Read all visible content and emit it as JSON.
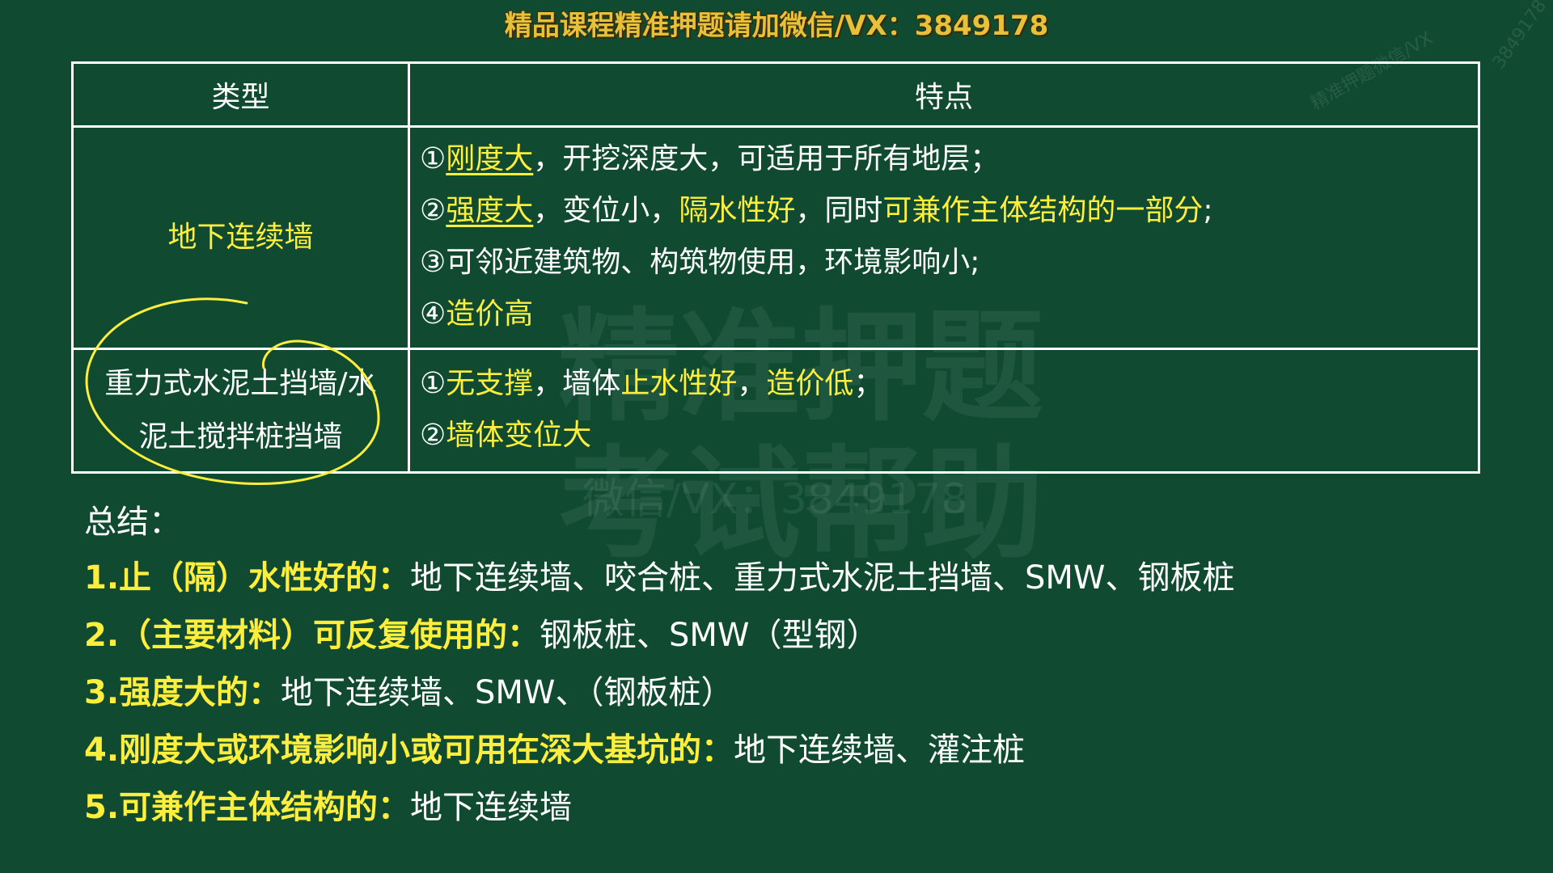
{
  "banner": "精品课程精准押题请加微信/VX：3849178",
  "table": {
    "headers": [
      "类型",
      "特点"
    ],
    "rows": [
      {
        "type": "地下连续墙",
        "features": [
          [
            {
              "t": "①"
            },
            {
              "t": "刚度大",
              "y": true,
              "u": true
            },
            {
              "t": "，开挖深度大，可适用于所有地层；"
            }
          ],
          [
            {
              "t": "②"
            },
            {
              "t": "强度大",
              "y": true,
              "u": true
            },
            {
              "t": "，变位小，"
            },
            {
              "t": "隔水性好",
              "y": true
            },
            {
              "t": "，同时"
            },
            {
              "t": "可兼作主体结构的一部分",
              "y": true
            },
            {
              "t": ";"
            }
          ],
          [
            {
              "t": "③可邻近建筑物、构筑物使用，环境影响小;"
            }
          ],
          [
            {
              "t": "④"
            },
            {
              "t": "造价高",
              "y": true
            }
          ]
        ]
      },
      {
        "type_line1": "重力式水泥土挡墙/水",
        "type_line2": "泥土搅拌桩挡墙",
        "features": [
          [
            {
              "t": "①"
            },
            {
              "t": "无支撑",
              "y": true
            },
            {
              "t": "，墙体"
            },
            {
              "t": "止水性好",
              "y": true
            },
            {
              "t": "，"
            },
            {
              "t": "造价低",
              "y": true
            },
            {
              "t": "；"
            }
          ],
          [
            {
              "t": "②"
            },
            {
              "t": "墙体变位大",
              "y": true
            }
          ]
        ]
      }
    ]
  },
  "summary": {
    "title": "总结：",
    "items": [
      {
        "label": "1.止（隔）水性好的：",
        "text": "地下连续墙、咬合桩、重力式水泥土挡墙、SMW、钢板桩"
      },
      {
        "label": "2.（主要材料）可反复使用的：",
        "text": "钢板桩、SMW（型钢）"
      },
      {
        "label": "3.强度大的：",
        "text": "地下连续墙、SMW、（钢板桩）"
      },
      {
        "label": "4.刚度大或环境影响小或可用在深大基坑的：",
        "text": "地下连续墙、灌注桩"
      },
      {
        "label": "5.可兼作主体结构的：",
        "text": "地下连续墙"
      }
    ]
  },
  "watermark": {
    "main_line1": "精准押题",
    "main_line2": "考试帮助",
    "sub": "微信/VX：3849178",
    "side": "精准押题微信/VX",
    "corner": "3849178"
  },
  "colors": {
    "background": "#0f4a31",
    "highlight": "#ffee3b",
    "banner": "#e8c13a"
  }
}
